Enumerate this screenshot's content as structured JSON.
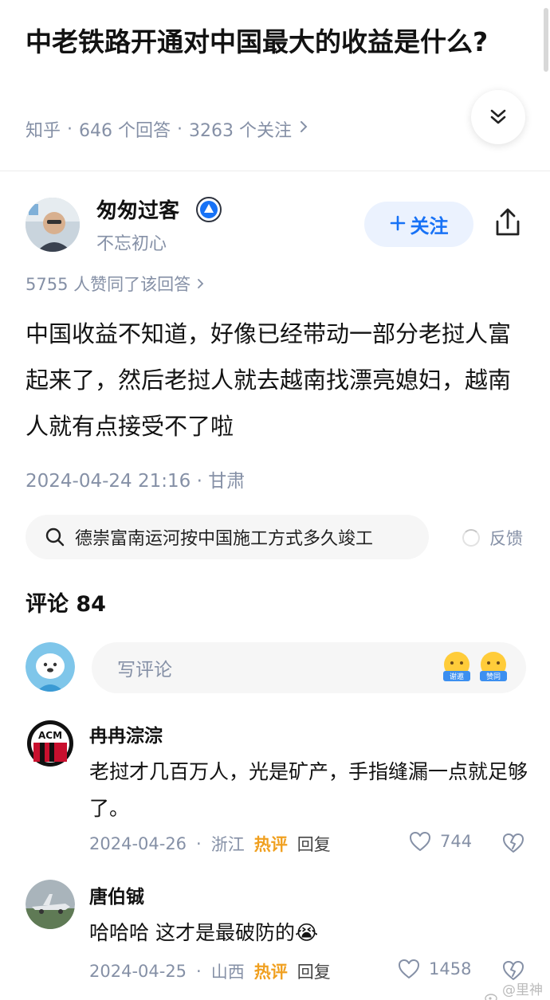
{
  "question": {
    "title": "中老铁路开通对中国最大的收益是什么?",
    "source": "知乎",
    "answers": "646 个回答",
    "follows": "3263 个关注"
  },
  "author": {
    "name": "匆匆过客",
    "bio": "不忘初心",
    "follow_label": "关注"
  },
  "answer": {
    "upvotes": "5755 人赞同了该回答",
    "body": "中国收益不知道，好像已经带动一部分老挝人富起来了，然后老挝人就去越南找漂亮媳妇，越南人就有点接受不了啦",
    "timestamp": "2024-04-24 21:16 · 甘肃"
  },
  "related_search": {
    "query": "德崇富南运河按中国施工方式多久竣工",
    "feedback": "反馈"
  },
  "comments_section": {
    "title": "评论 84",
    "compose_placeholder": "写评论",
    "emoji_labels": [
      "谢邀",
      "赞同"
    ]
  },
  "comments": [
    {
      "name": "冉冉淙淙",
      "text": "老挝才几百万人，光是矿产，手指缝漏一点就足够了。",
      "date": "2024-04-26",
      "location": "浙江",
      "hot_label": "热评",
      "reply_label": "回复",
      "likes": "744"
    },
    {
      "name": "唐伯铖",
      "text": "哈哈哈 这才是最破防的😭",
      "date": "2024-04-25",
      "location": "山西",
      "hot_label": "热评",
      "reply_label": "回复",
      "likes": "1458"
    }
  ],
  "watermark": "@里神裘",
  "colors": {
    "accent": "#1772f6",
    "muted": "#8590a6",
    "hot": "#f0a020"
  }
}
